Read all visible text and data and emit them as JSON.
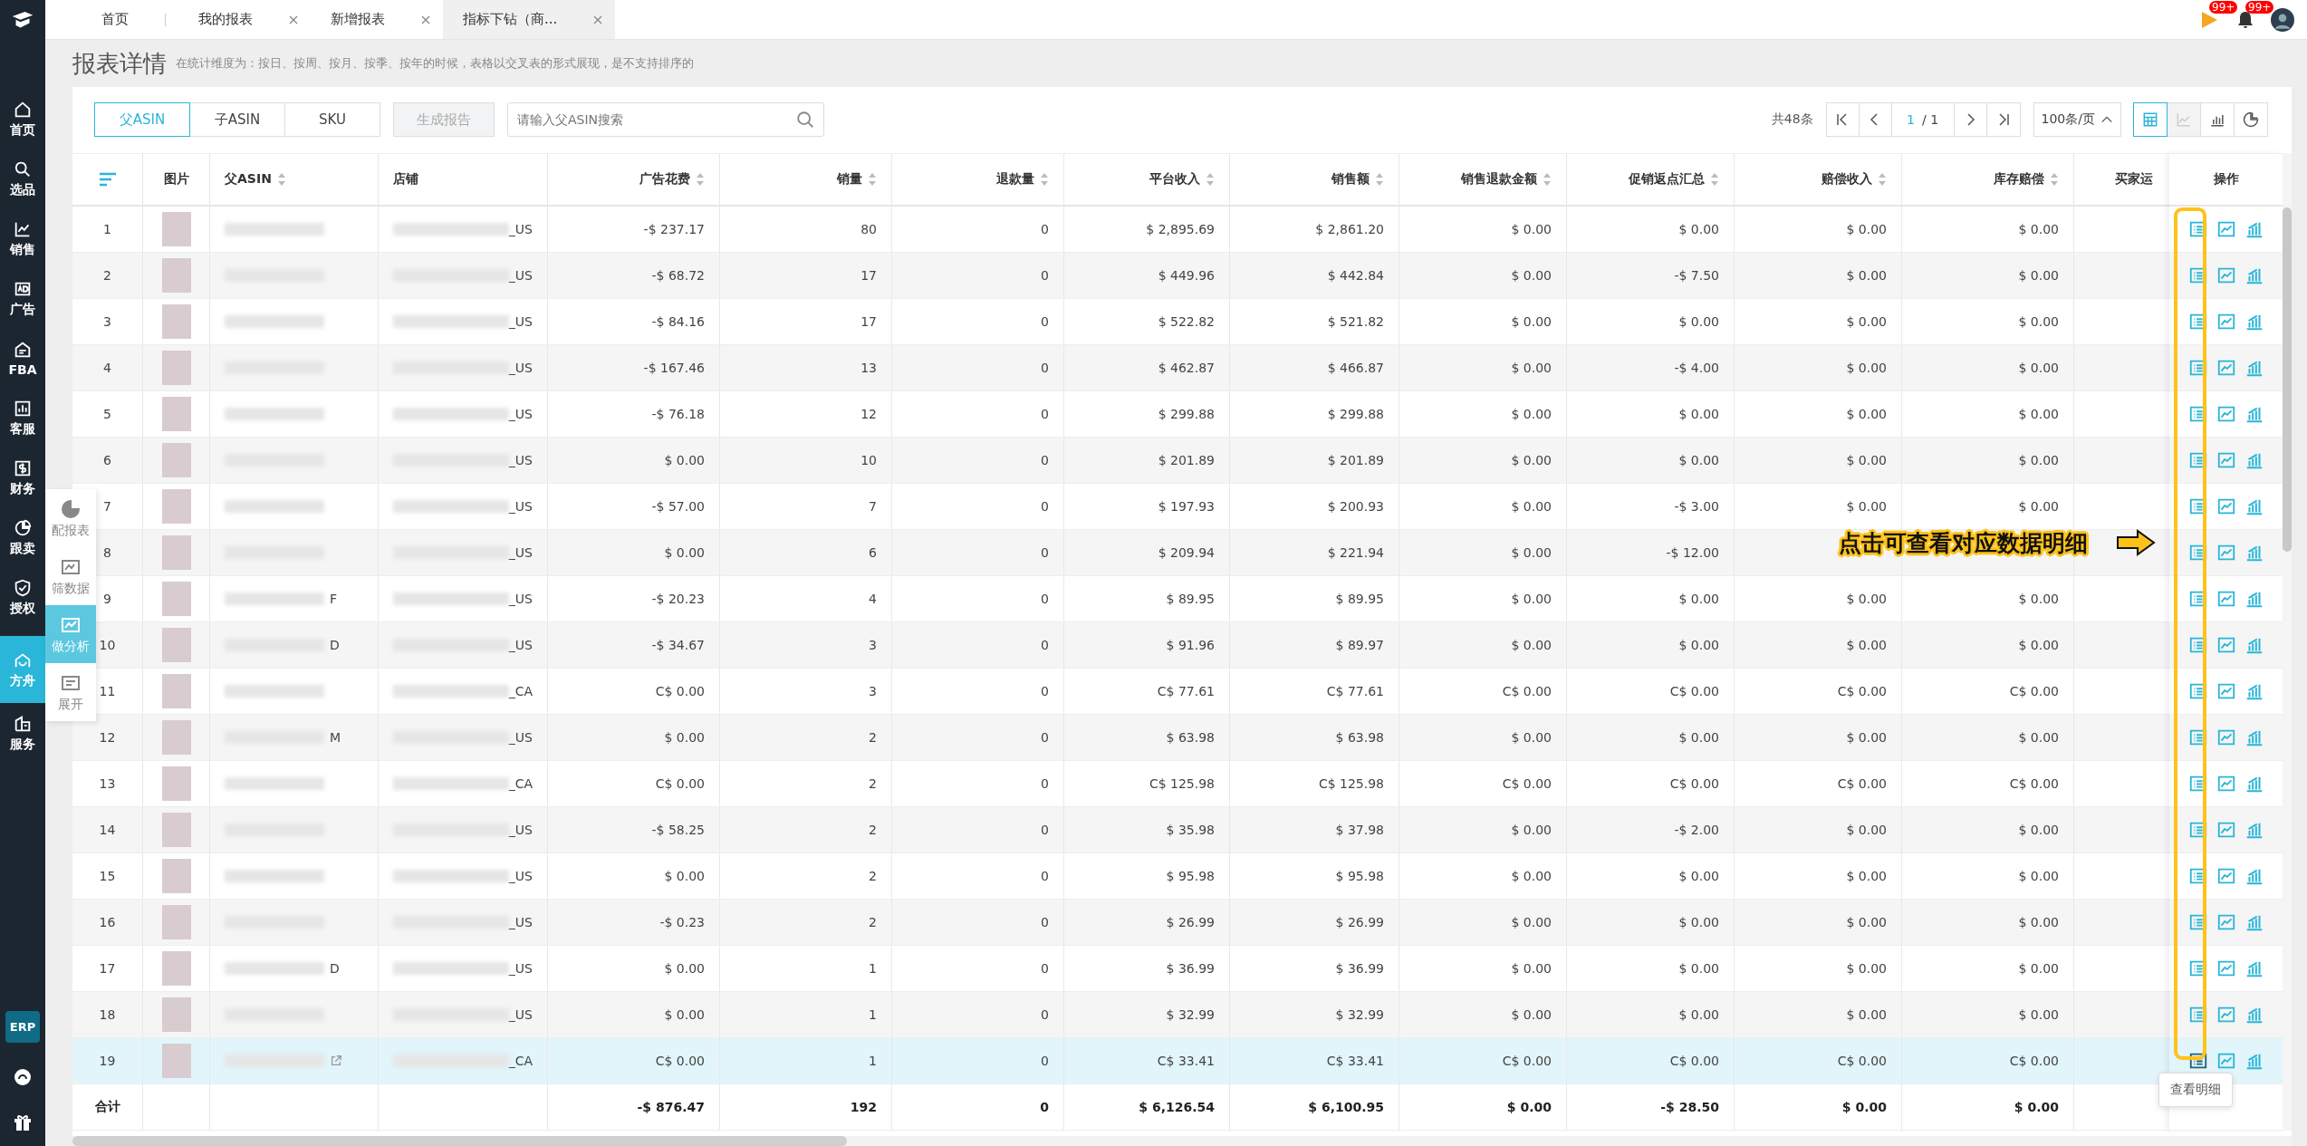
{
  "tabs": [
    {
      "label": "首页",
      "selected": false,
      "closable": false
    },
    {
      "label": "我的报表",
      "selected": false,
      "closable": true
    },
    {
      "label": "新增报表",
      "selected": false,
      "closable": true
    },
    {
      "label": "指标下钻（商...",
      "selected": true,
      "closable": true
    }
  ],
  "header": {
    "flag_badge": "99+",
    "bell_badge": "99+"
  },
  "sidebar": {
    "items": [
      {
        "label": "首页",
        "selected": false
      },
      {
        "label": "选品",
        "selected": false
      },
      {
        "label": "销售",
        "selected": false
      },
      {
        "label": "广告",
        "selected": false
      },
      {
        "label": "FBA",
        "selected": false
      },
      {
        "label": "客服",
        "selected": false
      },
      {
        "label": "财务",
        "selected": false
      },
      {
        "label": "跟卖",
        "selected": false
      },
      {
        "label": "授权",
        "selected": false
      },
      {
        "label": "方舟",
        "selected": true
      },
      {
        "label": "服务",
        "selected": false
      }
    ],
    "badge": "ERP"
  },
  "floating_menu": [
    {
      "label": "配报表",
      "selected": false
    },
    {
      "label": "筛数据",
      "selected": false
    },
    {
      "label": "做分析",
      "selected": true
    },
    {
      "label": "展开",
      "selected": false
    }
  ],
  "page": {
    "title": "报表详情",
    "hint": "在统计维度为：按日、按周、按月、按季、按年的时候，表格以交叉表的形式展现，是不支持排序的"
  },
  "toolbar": {
    "segments": [
      {
        "label": "父ASIN",
        "selected": true
      },
      {
        "label": "子ASIN",
        "selected": false
      },
      {
        "label": "SKU",
        "selected": false
      }
    ],
    "generate_button": {
      "label": "生成报告",
      "disabled": true
    },
    "search": {
      "placeholder": "请输入父ASIN搜索"
    }
  },
  "pagination": {
    "total": "共48条",
    "page": "1",
    "pages": "/ 1",
    "page_size": "100条/页",
    "view_toggles": [
      {
        "selected": true,
        "disabled": false
      },
      {
        "selected": false,
        "disabled": true
      },
      {
        "selected": false,
        "disabled": false
      },
      {
        "selected": false,
        "disabled": false
      }
    ]
  },
  "table": {
    "columns": [
      {
        "label": "图片",
        "sortable": false
      },
      {
        "label": "父ASIN",
        "sortable": true
      },
      {
        "label": "店铺",
        "sortable": false
      },
      {
        "label": "广告花费",
        "sortable": true
      },
      {
        "label": "销量",
        "sortable": true
      },
      {
        "label": "退款量",
        "sortable": true
      },
      {
        "label": "平台收入",
        "sortable": true
      },
      {
        "label": "销售额",
        "sortable": true
      },
      {
        "label": "销售退款金额",
        "sortable": true
      },
      {
        "label": "促销返点汇总",
        "sortable": true
      },
      {
        "label": "赔偿收入",
        "sortable": true
      },
      {
        "label": "库存赔偿",
        "sortable": true
      },
      {
        "label": "买家运",
        "sortable": false
      }
    ],
    "actions_header": "操作",
    "rows": [
      {
        "no": "1",
        "asin_tail": "",
        "link": false,
        "store": "_US",
        "hovered": false,
        "values": [
          "-$ 237.17",
          "80",
          "0",
          "$ 2,895.69",
          "$ 2,861.20",
          "$ 0.00",
          "$ 0.00",
          "$ 0.00",
          "$ 0.00"
        ]
      },
      {
        "no": "2",
        "asin_tail": "",
        "link": false,
        "store": "_US",
        "hovered": false,
        "values": [
          "-$ 68.72",
          "17",
          "0",
          "$ 449.96",
          "$ 442.84",
          "$ 0.00",
          "-$ 7.50",
          "$ 0.00",
          "$ 0.00"
        ]
      },
      {
        "no": "3",
        "asin_tail": "",
        "link": false,
        "store": "_US",
        "hovered": false,
        "values": [
          "-$ 84.16",
          "17",
          "0",
          "$ 522.82",
          "$ 521.82",
          "$ 0.00",
          "$ 0.00",
          "$ 0.00",
          "$ 0.00"
        ]
      },
      {
        "no": "4",
        "asin_tail": "",
        "link": false,
        "store": "_US",
        "hovered": false,
        "values": [
          "-$ 167.46",
          "13",
          "0",
          "$ 462.87",
          "$ 466.87",
          "$ 0.00",
          "-$ 4.00",
          "$ 0.00",
          "$ 0.00"
        ]
      },
      {
        "no": "5",
        "asin_tail": "",
        "link": false,
        "store": "_US",
        "hovered": false,
        "values": [
          "-$ 76.18",
          "12",
          "0",
          "$ 299.88",
          "$ 299.88",
          "$ 0.00",
          "$ 0.00",
          "$ 0.00",
          "$ 0.00"
        ]
      },
      {
        "no": "6",
        "asin_tail": "",
        "link": false,
        "store": "_US",
        "hovered": false,
        "values": [
          "$ 0.00",
          "10",
          "0",
          "$ 201.89",
          "$ 201.89",
          "$ 0.00",
          "$ 0.00",
          "$ 0.00",
          "$ 0.00"
        ]
      },
      {
        "no": "7",
        "asin_tail": "",
        "link": false,
        "store": "_US",
        "hovered": false,
        "values": [
          "-$ 57.00",
          "7",
          "0",
          "$ 197.93",
          "$ 200.93",
          "$ 0.00",
          "-$ 3.00",
          "$ 0.00",
          "$ 0.00"
        ]
      },
      {
        "no": "8",
        "asin_tail": "",
        "link": false,
        "store": "_US",
        "hovered": false,
        "values": [
          "$ 0.00",
          "6",
          "0",
          "$ 209.94",
          "$ 221.94",
          "$ 0.00",
          "-$ 12.00"
        ]
      },
      {
        "no": "9",
        "asin_tail": "F",
        "link": false,
        "store": "_US",
        "hovered": false,
        "values": [
          "-$ 20.23",
          "4",
          "0",
          "$ 89.95",
          "$ 89.95",
          "$ 0.00",
          "$ 0.00",
          "$ 0.00",
          "$ 0.00"
        ]
      },
      {
        "no": "10",
        "asin_tail": "D",
        "link": false,
        "store": "_US",
        "hovered": false,
        "values": [
          "-$ 34.67",
          "3",
          "0",
          "$ 91.96",
          "$ 89.97",
          "$ 0.00",
          "$ 0.00",
          "$ 0.00",
          "$ 0.00"
        ]
      },
      {
        "no": "11",
        "asin_tail": "",
        "link": false,
        "store": "_CA",
        "hovered": false,
        "values": [
          "C$ 0.00",
          "3",
          "0",
          "C$ 77.61",
          "C$ 77.61",
          "C$ 0.00",
          "C$ 0.00",
          "C$ 0.00",
          "C$ 0.00"
        ]
      },
      {
        "no": "12",
        "asin_tail": "M",
        "link": false,
        "store": "_US",
        "hovered": false,
        "values": [
          "$ 0.00",
          "2",
          "0",
          "$ 63.98",
          "$ 63.98",
          "$ 0.00",
          "$ 0.00",
          "$ 0.00",
          "$ 0.00"
        ]
      },
      {
        "no": "13",
        "asin_tail": "",
        "link": false,
        "store": "_CA",
        "hovered": false,
        "values": [
          "C$ 0.00",
          "2",
          "0",
          "C$ 125.98",
          "C$ 125.98",
          "C$ 0.00",
          "C$ 0.00",
          "C$ 0.00",
          "C$ 0.00"
        ]
      },
      {
        "no": "14",
        "asin_tail": "",
        "link": false,
        "store": "_US",
        "hovered": false,
        "values": [
          "-$ 58.25",
          "2",
          "0",
          "$ 35.98",
          "$ 37.98",
          "$ 0.00",
          "-$ 2.00",
          "$ 0.00",
          "$ 0.00"
        ]
      },
      {
        "no": "15",
        "asin_tail": "",
        "link": false,
        "store": "_US",
        "hovered": false,
        "values": [
          "$ 0.00",
          "2",
          "0",
          "$ 95.98",
          "$ 95.98",
          "$ 0.00",
          "$ 0.00",
          "$ 0.00",
          "$ 0.00"
        ]
      },
      {
        "no": "16",
        "asin_tail": "",
        "link": false,
        "store": "_US",
        "hovered": false,
        "values": [
          "-$ 0.23",
          "2",
          "0",
          "$ 26.99",
          "$ 26.99",
          "$ 0.00",
          "$ 0.00",
          "$ 0.00",
          "$ 0.00"
        ]
      },
      {
        "no": "17",
        "asin_tail": "D",
        "link": false,
        "store": "_US",
        "hovered": false,
        "values": [
          "$ 0.00",
          "1",
          "0",
          "$ 36.99",
          "$ 36.99",
          "$ 0.00",
          "$ 0.00",
          "$ 0.00",
          "$ 0.00"
        ]
      },
      {
        "no": "18",
        "asin_tail": "",
        "link": false,
        "store": "_US",
        "hovered": false,
        "values": [
          "$ 0.00",
          "1",
          "0",
          "$ 32.99",
          "$ 32.99",
          "$ 0.00",
          "$ 0.00",
          "$ 0.00",
          "$ 0.00"
        ]
      },
      {
        "no": "19",
        "asin_tail": "",
        "link": true,
        "store": "_CA",
        "hovered": true,
        "values": [
          "C$ 0.00",
          "1",
          "0",
          "C$ 33.41",
          "C$ 33.41",
          "C$ 0.00",
          "C$ 0.00",
          "C$ 0.00",
          "C$ 0.00"
        ]
      }
    ],
    "total": {
      "label": "合计",
      "values": [
        "-$ 876.47",
        "192",
        "0",
        "$ 6,126.54",
        "$ 6,100.95",
        "$ 0.00",
        "-$ 28.50",
        "$ 0.00",
        "$ 0.00"
      ]
    }
  },
  "annotation": {
    "text": "点击可查看对应数据明细"
  },
  "tooltip": {
    "text": "查看明细"
  }
}
